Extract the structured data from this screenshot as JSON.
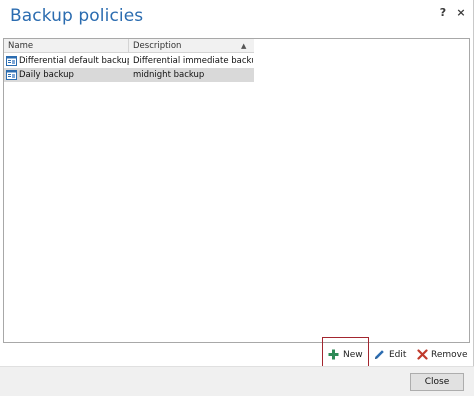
{
  "window": {
    "title": "Backup policies",
    "help_label": "?",
    "close_label": "×"
  },
  "table": {
    "columns": [
      "Name",
      "Description"
    ],
    "rows": [
      {
        "name": "Differential default backup",
        "description": "Differential immediate backup",
        "selected": false
      },
      {
        "name": "Daily backup",
        "description": "midnight backup",
        "selected": true
      }
    ]
  },
  "actions": {
    "new_label": "New",
    "edit_label": "Edit",
    "remove_label": "Remove"
  },
  "footer": {
    "close_label": "Close"
  },
  "colors": {
    "title": "#2b6cb0",
    "selected_row": "#d9d9d9",
    "new_icon": "#2e8b57",
    "edit_icon": "#2b6cb0",
    "remove_icon": "#c0392b",
    "highlight_border": "#a3262f"
  },
  "icons": {
    "row": "policy-icon",
    "new": "plus-icon",
    "edit": "pencil-icon",
    "remove": "x-icon",
    "sort": "sort-ascending-icon"
  }
}
